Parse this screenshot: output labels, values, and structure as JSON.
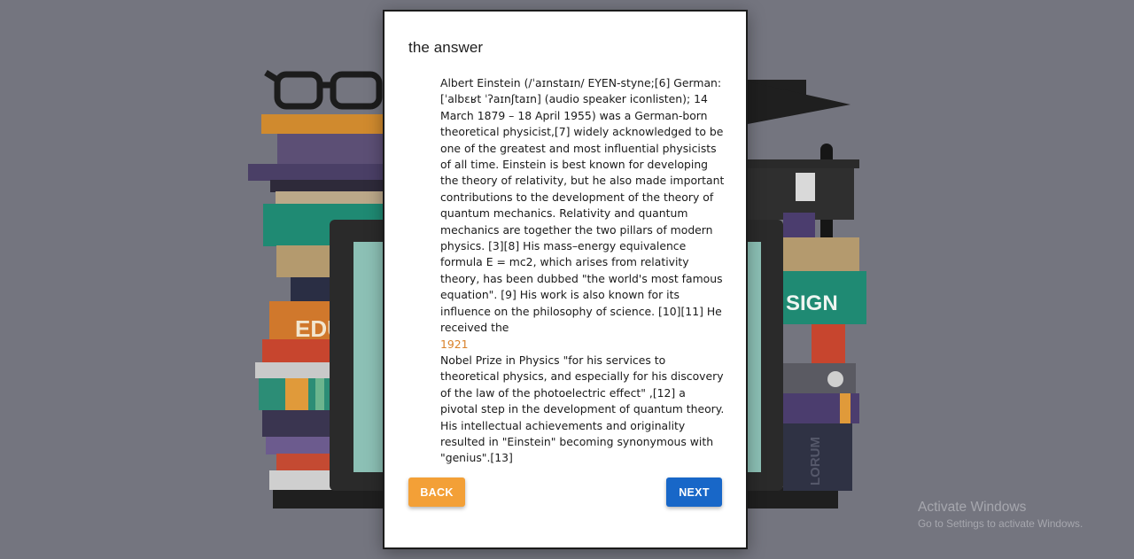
{
  "dialog": {
    "title": "the answer",
    "paragraph_1": "Albert Einstein (/ˈaɪnstaɪn/ EYEN-styne;[6] German: [ˈalbɛʁt ˈʔaɪnʃtaɪn] (audio speaker iconlisten); 14 March 1879 – 18 April 1955) was a German-born theoretical physicist,[7] widely acknowledged to be one of the greatest and most influential physicists of all time. Einstein is best known for developing the theory of relativity, but he also made important contributions to the development of the theory of quantum mechanics. Relativity and quantum mechanics are together the two pillars of modern physics. [3][8] His mass–energy equivalence formula E = mc2, which arises from relativity theory, has been dubbed \"the world's most famous equation\". [9] His work is also known for its influence on the philosophy of science. [10][11] He received the",
    "highlight_year": "1921",
    "paragraph_2": "Nobel Prize in Physics \"for his services to theoretical physics, and especially for his discovery of the law of the photoelectric effect\" ,[12] a pivotal step in the development of quantum theory. His intellectual achievements and originality resulted in \"Einstein\" becoming synonymous with \"genius\".[13]",
    "back_label": "BACK",
    "next_label": "NEXT"
  },
  "background": {
    "book_label_left": "EDU",
    "book_label_right": "SIGN",
    "book_label_vertical": "LORUM"
  },
  "watermark": {
    "title": "Activate Windows",
    "subtitle": "Go to Settings to activate Windows."
  },
  "colors": {
    "page_bg": "#74757f",
    "back_button": "#f3a037",
    "next_button": "#1867c8",
    "year_highlight": "#d9822b"
  }
}
